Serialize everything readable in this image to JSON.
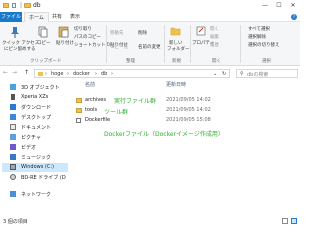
{
  "window": {
    "title": "db",
    "minimize": "—",
    "maximize": "☐",
    "close": "✕"
  },
  "tabs": {
    "file": "ファイル",
    "home": "ホーム",
    "share": "共有",
    "view": "表示",
    "help": "?"
  },
  "ribbon": {
    "pin": "クイック アクセス",
    "pin2": "にピン留めする",
    "copy": "コピー",
    "paste": "貼り付け",
    "cut": "切り取り",
    "copy_path": "パスのコピー",
    "paste_shortcut": "ショートカットの貼り付け",
    "move_to": "移動先",
    "copy_to": "コピー先",
    "delete": "削除",
    "rename": "名前の変更",
    "new_folder": "新しい",
    "new_folder2": "フォルダー",
    "new_item": "新しいアイテム",
    "easy_access": "ショートカット",
    "properties": "プロパティ",
    "open": "開く",
    "edit": "編集",
    "history": "履歴",
    "select_all": "すべて選択",
    "select_none": "選択解除",
    "invert_selection": "選択の切り替え",
    "group_clipboard": "クリップボード",
    "group_organize": "整理",
    "group_new": "新規",
    "group_open": "開く",
    "group_select": "選択"
  },
  "address": {
    "back": "←",
    "forward": "→",
    "up": "↑",
    "crumbs": [
      "›",
      "hoge",
      "›",
      "docker",
      "›",
      "db",
      "›"
    ],
    "refresh": "↻",
    "dropdown": "⌄",
    "search_placeholder": "dbの検索",
    "search_icon": "magnifier-icon"
  },
  "navpane": {
    "items": [
      {
        "label": "3D オブジェクト",
        "icon": "cube-icon"
      },
      {
        "label": "Xperia XZs",
        "icon": "phone-icon"
      },
      {
        "label": "ダウンロード",
        "icon": "download-icon"
      },
      {
        "label": "デスクトップ",
        "icon": "desktop-icon"
      },
      {
        "label": "ドキュメント",
        "icon": "document-icon"
      },
      {
        "label": "ピクチャ",
        "icon": "picture-icon"
      },
      {
        "label": "ビデオ",
        "icon": "video-icon"
      },
      {
        "label": "ミュージック",
        "icon": "music-icon"
      },
      {
        "label": "Windows (C:)",
        "icon": "drive-icon"
      },
      {
        "label": "BD-RE ドライブ (D",
        "icon": "disc-icon"
      },
      {
        "label": "ネットワーク",
        "icon": "network-icon"
      }
    ]
  },
  "filelist": {
    "col_name": "名前",
    "col_date": "更新日時",
    "rows": [
      {
        "name": "archives",
        "date": "2021/09/05 14:02",
        "type": "folder"
      },
      {
        "name": "tools",
        "date": "2021/09/05 14:02",
        "type": "folder"
      },
      {
        "name": "Dockerfile",
        "date": "2021/09/05 15:08",
        "type": "file"
      }
    ],
    "notes": {
      "archives": "実行ファイル群",
      "tools": "ツール群",
      "dockerfile": "Dockerファイル（Dockerイメージ作成用）"
    }
  },
  "status": {
    "text": "3 個の項目"
  },
  "colors": {
    "accent": "#1979ca",
    "annotation": "#2fae2f",
    "folder": "#f0c24b",
    "selected": "#cce8ff"
  }
}
